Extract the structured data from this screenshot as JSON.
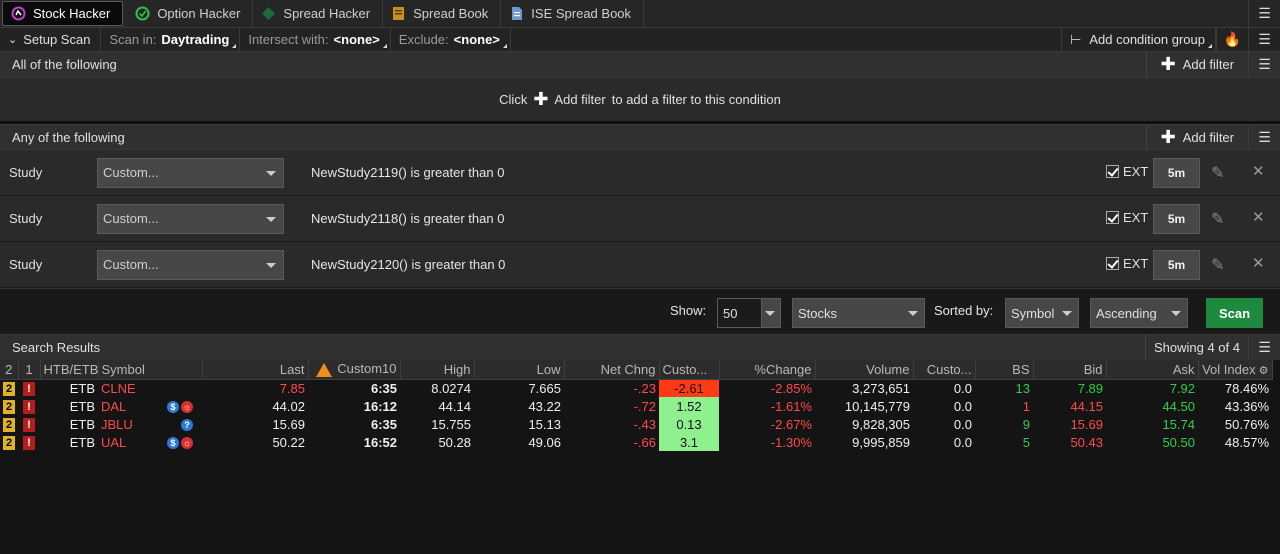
{
  "tabs": [
    {
      "label": "Stock Hacker",
      "icon": "stock-hacker-icon",
      "color": "#c040c8"
    },
    {
      "label": "Option Hacker",
      "icon": "option-hacker-icon",
      "color": "#2ec04a"
    },
    {
      "label": "Spread Hacker",
      "icon": "spread-hacker-icon",
      "color": "#1e6a3a"
    },
    {
      "label": "Spread Book",
      "icon": "spread-book-icon",
      "color": "#c89020"
    },
    {
      "label": "ISE Spread Book",
      "icon": "ise-spread-book-icon",
      "color": "#6a9ad0"
    }
  ],
  "setup": {
    "setup_label": "Setup Scan",
    "scan_in_label": "Scan in:",
    "scan_in_value": "Daytrading",
    "intersect_label": "Intersect with:",
    "intersect_value": "<none>",
    "exclude_label": "Exclude:",
    "exclude_value": "<none>",
    "add_group_label": "Add condition group"
  },
  "all_section": {
    "title": "All of the following",
    "add_filter": "Add filter",
    "empty_prefix": "Click",
    "empty_link": "Add filter",
    "empty_suffix": "to add a filter to this condition"
  },
  "any_section": {
    "title": "Any of the following",
    "add_filter": "Add filter"
  },
  "studies": [
    {
      "label": "Study",
      "select": "Custom...",
      "condition": "NewStudy2119() is greater than 0",
      "ext": "EXT",
      "agg": "5m"
    },
    {
      "label": "Study",
      "select": "Custom...",
      "condition": "NewStudy2118() is greater than 0",
      "ext": "EXT",
      "agg": "5m"
    },
    {
      "label": "Study",
      "select": "Custom...",
      "condition": "NewStudy2120() is greater than 0",
      "ext": "EXT",
      "agg": "5m"
    }
  ],
  "showbar": {
    "show_label": "Show:",
    "show_value": "50",
    "type_value": "Stocks",
    "sorted_label": "Sorted by:",
    "sort_value": "Symbol",
    "order_value": "Ascending",
    "scan_label": "Scan"
  },
  "results": {
    "title": "Search Results",
    "showing": "Showing 4 of 4",
    "columns": [
      "2",
      "1",
      "HTB/ETB",
      "Symbol",
      "Last",
      "Custom10",
      "High",
      "Low",
      "Net Chng",
      "Custo...",
      "%Change",
      "Volume",
      "Custo...",
      "BS",
      "Bid",
      "Ask",
      "Vol Index"
    ],
    "rows": [
      {
        "b2": "2",
        "b1": "!",
        "etb": "ETB",
        "symbol": "CLNE",
        "icons": [],
        "last": "7.85",
        "custom10": "6:35",
        "high": "8.0274",
        "low": "7.665",
        "netchng": "-.23",
        "custo1": "-2.61",
        "pct": "-2.85%",
        "volume": "3,273,651",
        "custo2": "0.0",
        "bs": "13",
        "bid": "7.89",
        "ask": "7.92",
        "volindex": "78.46%"
      },
      {
        "b2": "2",
        "b1": "!",
        "etb": "ETB",
        "symbol": "DAL",
        "icons": [
          "B",
          "R"
        ],
        "last": "44.02",
        "custom10": "16:12",
        "high": "44.14",
        "low": "43.22",
        "netchng": "-.72",
        "custo1": "1.52",
        "pct": "-1.61%",
        "volume": "10,145,779",
        "custo2": "0.0",
        "bs": "1",
        "bid": "44.15",
        "ask": "44.50",
        "volindex": "43.36%"
      },
      {
        "b2": "2",
        "b1": "!",
        "etb": "ETB",
        "symbol": "JBLU",
        "icons": [
          "?"
        ],
        "last": "15.69",
        "custom10": "6:35",
        "high": "15.755",
        "low": "15.13",
        "netchng": "-.43",
        "custo1": "0.13",
        "pct": "-2.67%",
        "volume": "9,828,305",
        "custo2": "0.0",
        "bs": "9",
        "bid": "15.69",
        "ask": "15.74",
        "volindex": "50.76%"
      },
      {
        "b2": "2",
        "b1": "!",
        "etb": "ETB",
        "symbol": "UAL",
        "icons": [
          "B",
          "R"
        ],
        "last": "50.22",
        "custom10": "16:52",
        "high": "50.28",
        "low": "49.06",
        "netchng": "-.66",
        "custo1": "3.1",
        "pct": "-1.30%",
        "volume": "9,995,859",
        "custo2": "0.0",
        "bs": "5",
        "bid": "50.43",
        "ask": "50.50",
        "volindex": "48.57%"
      }
    ]
  }
}
